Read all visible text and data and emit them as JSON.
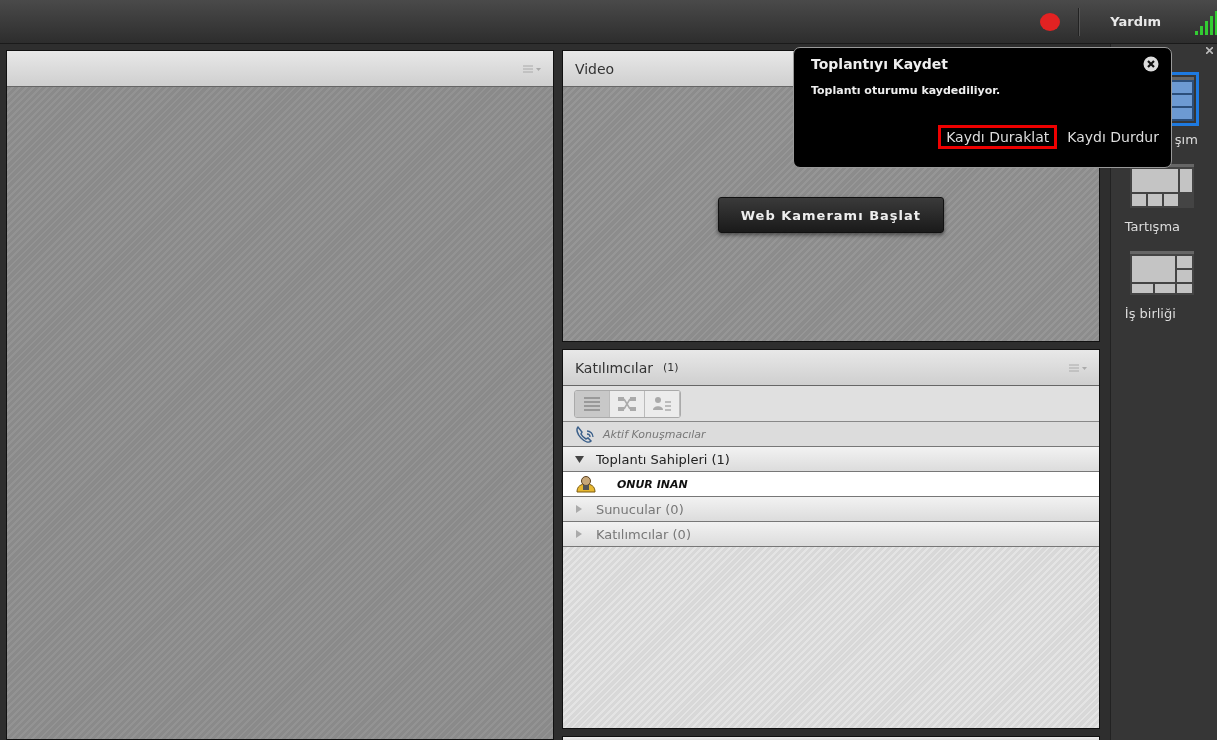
{
  "top_bar": {
    "recording": true,
    "help": "Yardım"
  },
  "video_pod": {
    "title": "Video",
    "start_button": "Web Kameramı Başlat"
  },
  "attendees_pod": {
    "title": "Katılımcılar",
    "count": "(1)",
    "view_buttons": [
      {
        "kind": "list",
        "selected": true
      },
      {
        "kind": "map",
        "selected": false
      },
      {
        "kind": "card",
        "selected": false
      }
    ],
    "active_speakers": "Aktif Konuşmacılar",
    "groups": [
      {
        "label": "Toplantı Sahipleri (1)",
        "expanded": true,
        "children": [
          {
            "name": "ONUR INAN"
          }
        ]
      },
      {
        "label": "Sunucular (0)",
        "expanded": false
      },
      {
        "label": "Katılımcılar (0)",
        "expanded": false
      }
    ]
  },
  "layouts": [
    {
      "label": "şım",
      "kind": "share",
      "selected": true
    },
    {
      "label": "Tartışma",
      "kind": "discussion",
      "selected": false
    },
    {
      "label": "İş birliği",
      "kind": "collaboration",
      "selected": false
    }
  ],
  "popup": {
    "title": "Toplantıyı Kaydet",
    "message": "Toplantı oturumu kaydediliyor.",
    "buttons": [
      {
        "label": "Kaydı Duraklat",
        "highlighted": true
      },
      {
        "label": "Kaydı Durdur",
        "highlighted": false
      }
    ]
  }
}
